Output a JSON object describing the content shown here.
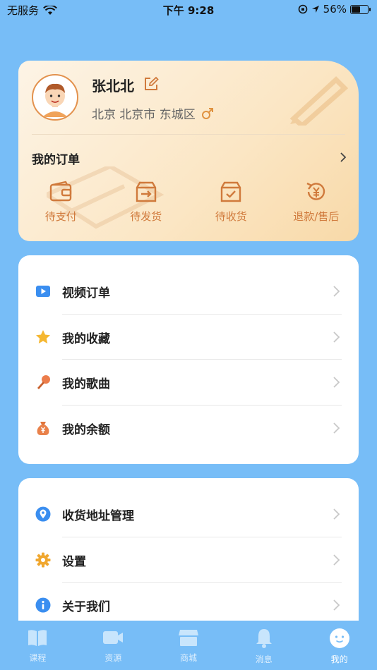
{
  "status_bar": {
    "carrier": "无服务",
    "time": "下午 9:28",
    "battery_percent": "56%",
    "battery_level": 0.56
  },
  "profile": {
    "name": "张北北",
    "location": "北京 北京市 东城区",
    "gender_icon": "male-icon"
  },
  "orders": {
    "title": "我的订单",
    "items": [
      {
        "label": "待支付",
        "icon": "wallet-icon"
      },
      {
        "label": "待发货",
        "icon": "shipping-box-icon"
      },
      {
        "label": "待收货",
        "icon": "check-box-icon"
      },
      {
        "label": "退款/售后",
        "icon": "refund-icon"
      }
    ]
  },
  "menu1": [
    {
      "label": "视频订单",
      "icon": "video-icon"
    },
    {
      "label": "我的收藏",
      "icon": "star-icon"
    },
    {
      "label": "我的歌曲",
      "icon": "microphone-icon"
    },
    {
      "label": "我的余额",
      "icon": "money-bag-icon"
    }
  ],
  "menu2": [
    {
      "label": "收货地址管理",
      "icon": "location-pin-icon"
    },
    {
      "label": "设置",
      "icon": "gear-icon"
    },
    {
      "label": "关于我们",
      "icon": "info-icon"
    }
  ],
  "tabs": [
    {
      "label": "课程",
      "icon": "book-icon"
    },
    {
      "label": "资源",
      "icon": "camera-icon"
    },
    {
      "label": "商城",
      "icon": "shop-icon"
    },
    {
      "label": "消息",
      "icon": "bell-icon"
    },
    {
      "label": "我的",
      "icon": "face-icon",
      "active": true
    }
  ],
  "colors": {
    "background": "#77bdf7",
    "accent_orange": "#d07a3c",
    "card_gradient_start": "#fdf4e6",
    "card_gradient_end": "#f8d9a8"
  }
}
